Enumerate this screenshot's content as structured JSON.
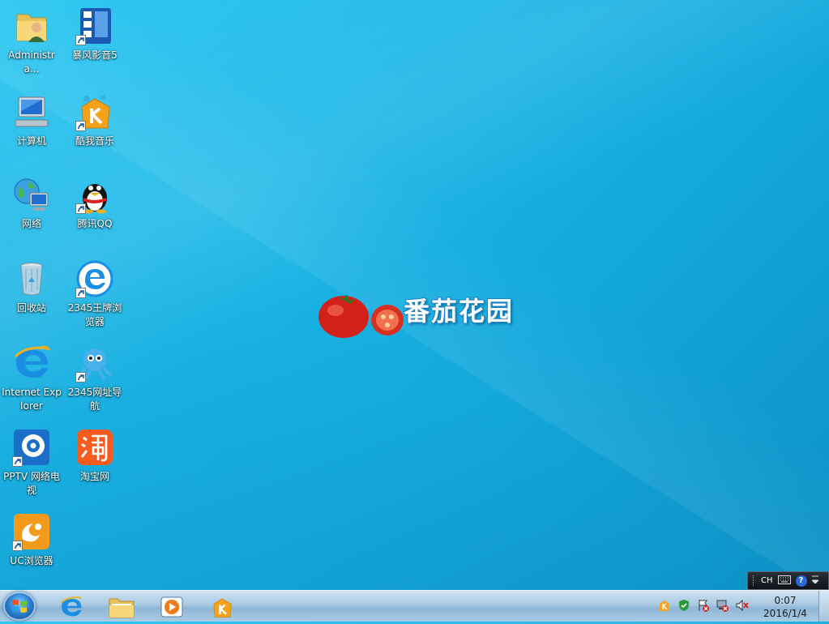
{
  "desktop": {
    "icons": [
      {
        "label": "Administra..."
      },
      {
        "label": "暴风影音5"
      },
      {
        "label": "计算机"
      },
      {
        "label": "酷我音乐"
      },
      {
        "label": "网络"
      },
      {
        "label": "腾讯QQ"
      },
      {
        "label": "回收站"
      },
      {
        "label": "2345王牌浏览器"
      },
      {
        "label": "Internet Explorer"
      },
      {
        "label": "2345网址导航"
      },
      {
        "label": "PPTV 网络电视"
      },
      {
        "label": "淘宝网"
      },
      {
        "label": "UC浏览器"
      }
    ]
  },
  "wallpaper": {
    "logo_text": "番茄花园"
  },
  "langbar": {
    "lang": "CH",
    "help": "?"
  },
  "taskbar": {
    "time": "0:07",
    "date": "2016/1/4"
  },
  "colors": {
    "desktop": "#1cb8e8",
    "taskbar": "#a9c9e2"
  }
}
